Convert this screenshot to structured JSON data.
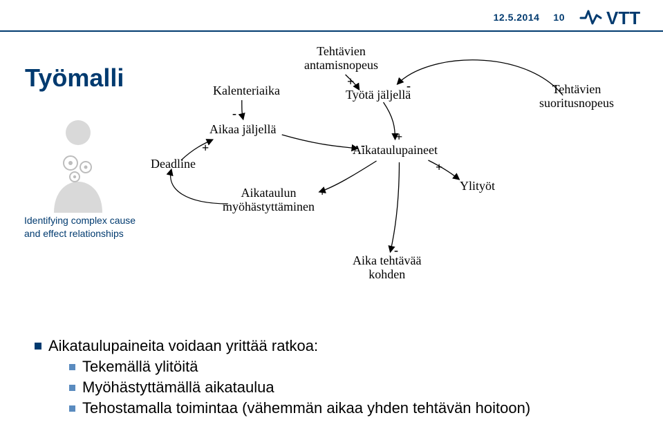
{
  "header": {
    "date": "12.5.2014",
    "pagenum": "10",
    "logo_text": "VTT"
  },
  "title": "Työmalli",
  "caption": {
    "line1": "Identifying complex cause",
    "line2": "and effect relationships"
  },
  "nodes": {
    "tehtavien_antamisnopeus": "Tehtävien\nantamisnopeus",
    "kalenteriaika": "Kalenteriaika",
    "aikaa_jaljella": "Aikaa jäljellä",
    "tyota_jaljella": "Työtä jäljellä",
    "tehtavien_suoritusnopeus": "Tehtävien\nsuoritusnopeus",
    "aikataulupaineet": "Aikataulupaineet",
    "ylityot": "Ylityöt",
    "aikataulun_myohastyttaminen": "Aikataulun\nmyöhästyttäminen",
    "aika_tehtavaa_kohden": "Aika tehtävää\nkohden",
    "deadline": "Deadline"
  },
  "signs": {
    "s1": "+",
    "s2": "-",
    "s3": "-",
    "s4": "+",
    "s5": "-",
    "s6": "+",
    "s7": "+",
    "s8": "+",
    "s9": "-"
  },
  "bullets": {
    "b0": "Aikataulupaineita voidaan yrittää ratkoa:",
    "b1": "Tekemällä ylitöitä",
    "b2": "Myöhästyttämällä aikataulua",
    "b3": "Tehostamalla toimintaa (vähemmän aikaa yhden tehtävän hoitoon)"
  },
  "chart_data": {
    "type": "causal-loop-diagram",
    "nodes": [
      {
        "id": "tehtavien_antamisnopeus",
        "label": "Tehtävien antamisnopeus"
      },
      {
        "id": "kalenteriaika",
        "label": "Kalenteriaika"
      },
      {
        "id": "aikaa_jaljella",
        "label": "Aikaa jäljellä"
      },
      {
        "id": "deadline",
        "label": "Deadline"
      },
      {
        "id": "tyota_jaljella",
        "label": "Työtä jäljellä"
      },
      {
        "id": "tehtavien_suoritusnopeus",
        "label": "Tehtävien suoritusnopeus"
      },
      {
        "id": "aikataulupaineet",
        "label": "Aikataulupaineet"
      },
      {
        "id": "ylityot",
        "label": "Ylityöt"
      },
      {
        "id": "aikataulun_myohastyttaminen",
        "label": "Aikataulun myöhästyttäminen"
      },
      {
        "id": "aika_tehtavaa_kohden",
        "label": "Aika tehtävää kohden"
      }
    ],
    "edges": [
      {
        "from": "tehtavien_antamisnopeus",
        "to": "tyota_jaljella",
        "polarity": "+"
      },
      {
        "from": "tehtavien_suoritusnopeus",
        "to": "tyota_jaljella",
        "polarity": "-"
      },
      {
        "from": "kalenteriaika",
        "to": "aikaa_jaljella",
        "polarity": "-"
      },
      {
        "from": "deadline",
        "to": "aikaa_jaljella",
        "polarity": "+"
      },
      {
        "from": "tyota_jaljella",
        "to": "aikataulupaineet",
        "polarity": "+"
      },
      {
        "from": "aikaa_jaljella",
        "to": "aikataulupaineet",
        "polarity": "-"
      },
      {
        "from": "aikataulupaineet",
        "to": "ylityot",
        "polarity": "+"
      },
      {
        "from": "aikataulupaineet",
        "to": "aikataulun_myohastyttaminen",
        "polarity": "+"
      },
      {
        "from": "aikataulupaineet",
        "to": "aika_tehtavaa_kohden",
        "polarity": "-"
      },
      {
        "from": "aikataulun_myohastyttaminen",
        "to": "deadline",
        "polarity": ""
      }
    ]
  }
}
